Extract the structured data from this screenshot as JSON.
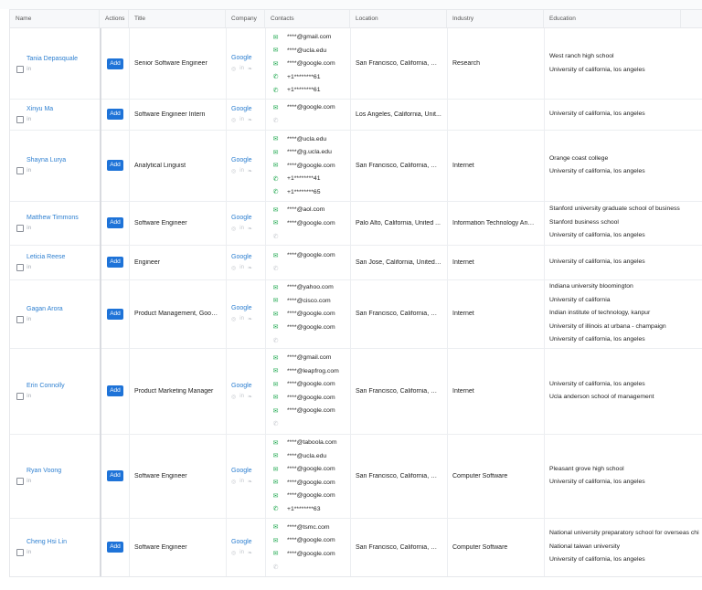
{
  "columns": [
    "Name",
    "Actions",
    "Title",
    "Company",
    "Contacts",
    "Location",
    "Industry",
    "Education"
  ],
  "add_label": "Add",
  "linkedin_glyph": "in",
  "rows": [
    {
      "name": "Tania Depasquale",
      "title": "Senior Software Engineer",
      "company": "Google",
      "contacts": [
        {
          "t": "mail",
          "v": "****@gmail.com"
        },
        {
          "t": "mail",
          "v": "****@ucla.edu"
        },
        {
          "t": "mail",
          "v": "****@google.com"
        },
        {
          "t": "phone",
          "v": "+1********61"
        },
        {
          "t": "phone",
          "v": "+1********61"
        }
      ],
      "location": "San Francisco, California, Un...",
      "industry": "Research",
      "education": [
        "West ranch high school",
        "University of california, los angeles"
      ]
    },
    {
      "name": "Xinyu Ma",
      "title": "Software Engineer Intern",
      "company": "Google",
      "contacts": [
        {
          "t": "mail",
          "v": "****@google.com"
        },
        {
          "t": "phone-dim",
          "v": ""
        }
      ],
      "location": "Los Angeles, California, Unit...",
      "industry": "",
      "education": [
        "University of california, los angeles"
      ]
    },
    {
      "name": "Shayna Lurya",
      "title": "Analytical Linguist",
      "company": "Google",
      "contacts": [
        {
          "t": "mail",
          "v": "****@ucla.edu"
        },
        {
          "t": "mail",
          "v": "****@g.ucla.edu"
        },
        {
          "t": "mail",
          "v": "****@google.com"
        },
        {
          "t": "phone",
          "v": "+1********41"
        },
        {
          "t": "phone",
          "v": "+1********65"
        }
      ],
      "location": "San Francisco, California, Un...",
      "industry": "Internet",
      "education": [
        "Orange coast college",
        "University of california, los angeles"
      ]
    },
    {
      "name": "Matthew Timmons",
      "title": "Software Engineer",
      "company": "Google",
      "contacts": [
        {
          "t": "mail",
          "v": "****@aol.com"
        },
        {
          "t": "mail",
          "v": "****@google.com"
        },
        {
          "t": "phone-dim",
          "v": ""
        }
      ],
      "location": "Palo Alto, California, United ...",
      "industry": "Information Technology And ...",
      "education": [
        "Stanford university graduate school of business",
        "Stanford business school",
        "University of california, los angeles"
      ]
    },
    {
      "name": "Leticia Reese",
      "title": "Engineer",
      "company": "Google",
      "contacts": [
        {
          "t": "mail",
          "v": "****@google.com"
        },
        {
          "t": "phone-dim",
          "v": ""
        }
      ],
      "location": "San Jose, California, United ...",
      "industry": "Internet",
      "education": [
        "University of california, los angeles"
      ]
    },
    {
      "name": "Gagan Arora",
      "title": "Product Management, Googl...",
      "company": "Google",
      "contacts": [
        {
          "t": "mail",
          "v": "****@yahoo.com"
        },
        {
          "t": "mail",
          "v": "****@cisco.com"
        },
        {
          "t": "mail",
          "v": "****@google.com"
        },
        {
          "t": "mail",
          "v": "****@google.com"
        },
        {
          "t": "phone-dim",
          "v": ""
        }
      ],
      "location": "San Francisco, California, Un...",
      "industry": "Internet",
      "education": [
        "Indiana university bloomington",
        "University of california",
        "Indian institute of technology, kanpur",
        "University of illinois at urbana - champaign",
        "University of california, los angeles"
      ]
    },
    {
      "name": "Erin Connolly",
      "title": "Product Marketing Manager",
      "company": "Google",
      "contacts": [
        {
          "t": "mail",
          "v": "****@gmail.com"
        },
        {
          "t": "mail",
          "v": "****@leapfrog.com"
        },
        {
          "t": "mail",
          "v": "****@google.com"
        },
        {
          "t": "mail",
          "v": "****@google.com"
        },
        {
          "t": "mail",
          "v": "****@google.com"
        },
        {
          "t": "phone-dim",
          "v": ""
        }
      ],
      "location": "San Francisco, California, Un...",
      "industry": "Internet",
      "education": [
        "University of california, los angeles",
        "Ucla anderson school of management"
      ]
    },
    {
      "name": "Ryan Voong",
      "title": "Software Engineer",
      "company": "Google",
      "contacts": [
        {
          "t": "mail",
          "v": "****@taboola.com"
        },
        {
          "t": "mail",
          "v": "****@ucla.edu"
        },
        {
          "t": "mail",
          "v": "****@google.com"
        },
        {
          "t": "mail",
          "v": "****@google.com"
        },
        {
          "t": "mail",
          "v": "****@google.com"
        },
        {
          "t": "phone",
          "v": "+1********63"
        }
      ],
      "location": "San Francisco, California, Un...",
      "industry": "Computer Software",
      "education": [
        "Pleasant grove high school",
        "University of california, los angeles"
      ]
    },
    {
      "name": "Cheng Hsi Lin",
      "title": "Software Engineer",
      "company": "Google",
      "contacts": [
        {
          "t": "mail",
          "v": "****@tsmc.com"
        },
        {
          "t": "mail",
          "v": "****@google.com"
        },
        {
          "t": "mail",
          "v": "****@google.com"
        },
        {
          "t": "phone-dim",
          "v": ""
        }
      ],
      "location": "San Francisco, California, Un...",
      "industry": "Computer Software",
      "education": [
        "National university preparatory school for overseas chi",
        "National taiwan university",
        "University of california, los angeles"
      ]
    }
  ]
}
